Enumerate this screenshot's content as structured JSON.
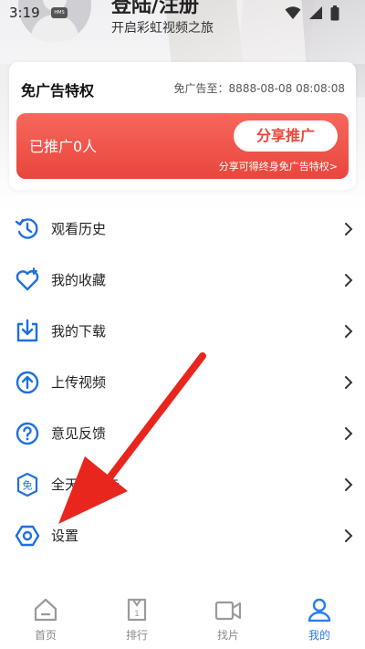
{
  "status_bar": {
    "time": "3:19",
    "badge": "HMS"
  },
  "profile": {
    "login_title": "登陆/注册",
    "subtitle": "开启彩虹视频之旅"
  },
  "ad_free_card": {
    "title": "免广告特权",
    "expiry": "免广告至：8888-08-08 08:08:08",
    "promoted_count": "已推广0人",
    "share_button": "分享推广",
    "share_hint": "分享可得终身免广告特权>"
  },
  "menu": {
    "items": [
      {
        "label": "观看历史",
        "icon": "history-icon"
      },
      {
        "label": "我的收藏",
        "icon": "heart-icon"
      },
      {
        "label": "我的下载",
        "icon": "download-icon"
      },
      {
        "label": "上传视频",
        "icon": "upload-icon"
      },
      {
        "label": "意见反馈",
        "icon": "question-icon"
      },
      {
        "label": "全天免广告",
        "icon": "ad-free-icon"
      },
      {
        "label": "设置",
        "icon": "settings-icon"
      }
    ]
  },
  "bottom_nav": {
    "items": [
      {
        "label": "首页",
        "icon": "home-icon",
        "active": false
      },
      {
        "label": "排行",
        "icon": "ranking-icon",
        "active": false
      },
      {
        "label": "找片",
        "icon": "video-camera-icon",
        "active": false
      },
      {
        "label": "我的",
        "icon": "person-icon",
        "active": true
      }
    ]
  },
  "colors": {
    "accent": "#2b7bf5",
    "promo": "#e8463c",
    "icon_blue": "#1f6fe0",
    "annotation_red": "#e8261e"
  }
}
